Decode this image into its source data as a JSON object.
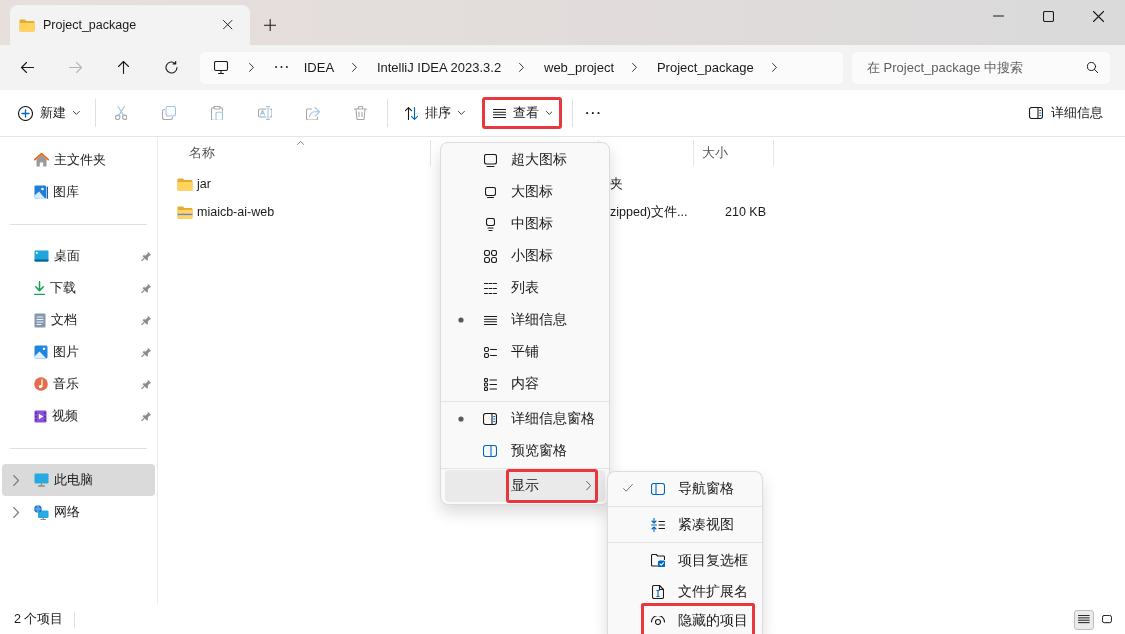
{
  "window": {
    "tabs": [
      {
        "title": "Project_package",
        "selected": true
      }
    ]
  },
  "navigation": {
    "buttons": [
      {
        "kind": "back",
        "disabled": false
      },
      {
        "kind": "forward",
        "disabled": true
      },
      {
        "kind": "up",
        "disabled": false
      },
      {
        "kind": "refresh",
        "disabled": false
      }
    ],
    "breadcrumb": [
      "IDEA",
      "IntelliJ IDEA 2023.3.2",
      "web_project",
      "Project_package"
    ],
    "search": {
      "placeholder": "在 Project_package 中搜索"
    }
  },
  "toolbar": {
    "create": {
      "label": "新建"
    },
    "actions": [
      {
        "kind": "cut",
        "disabled": true
      },
      {
        "kind": "copy",
        "disabled": true
      },
      {
        "kind": "paste",
        "disabled": true
      },
      {
        "kind": "rename",
        "disabled": true
      },
      {
        "kind": "share",
        "disabled": true
      },
      {
        "kind": "delete",
        "disabled": true
      }
    ],
    "sort": {
      "label": "排序"
    },
    "view": {
      "label": "查看",
      "highlighted": true
    },
    "details": {
      "label": "详细信息"
    }
  },
  "sidebar": {
    "groups": [
      [
        {
          "label": "主文件夹",
          "kind": "home",
          "pinned": false,
          "expandable": false,
          "selected": false
        },
        {
          "label": "图库",
          "kind": "gallery",
          "pinned": false,
          "expandable": false,
          "selected": false
        }
      ],
      [
        {
          "label": "桌面",
          "kind": "desktop",
          "pinned": true,
          "expandable": false,
          "selected": false
        },
        {
          "label": "下载",
          "kind": "downloads",
          "pinned": true,
          "expandable": false,
          "selected": false
        },
        {
          "label": "文档",
          "kind": "documents",
          "pinned": true,
          "expandable": false,
          "selected": false
        },
        {
          "label": "图片",
          "kind": "pictures",
          "pinned": true,
          "expandable": false,
          "selected": false
        },
        {
          "label": "音乐",
          "kind": "music",
          "pinned": true,
          "expandable": false,
          "selected": false
        },
        {
          "label": "视频",
          "kind": "videos",
          "pinned": true,
          "expandable": false,
          "selected": false
        }
      ],
      [
        {
          "label": "此电脑",
          "kind": "this-pc",
          "pinned": false,
          "expandable": true,
          "selected": true
        },
        {
          "label": "网络",
          "kind": "network",
          "pinned": false,
          "expandable": true,
          "selected": false
        }
      ]
    ]
  },
  "file_list": {
    "columns": [
      {
        "label": "名称",
        "kind": "name",
        "sorted": true
      },
      {
        "label": "大小",
        "kind": "size",
        "sorted": false
      }
    ],
    "rows": [
      {
        "name": "jar",
        "kind": "folder",
        "type": "夹"
      },
      {
        "name": "miaicb-ai-web",
        "kind": "zip",
        "type": "zipped)文件...",
        "size": "210 KB"
      }
    ]
  },
  "view_menu": {
    "groups": [
      [
        {
          "label": "超大图标",
          "kind": "extra-large-icons",
          "selected": false,
          "hovered": false,
          "highlighted": false
        },
        {
          "label": "大图标",
          "kind": "large-icons",
          "selected": false,
          "hovered": false,
          "highlighted": false
        },
        {
          "label": "中图标",
          "kind": "medium-icons",
          "selected": false,
          "hovered": false,
          "highlighted": false
        },
        {
          "label": "小图标",
          "kind": "small-icons",
          "selected": false,
          "hovered": false,
          "highlighted": false
        },
        {
          "label": "列表",
          "kind": "list",
          "selected": false,
          "hovered": false,
          "highlighted": false
        },
        {
          "label": "详细信息",
          "kind": "details",
          "selected": true,
          "hovered": false,
          "highlighted": false
        },
        {
          "label": "平铺",
          "kind": "tiles",
          "selected": false,
          "hovered": false,
          "highlighted": false
        },
        {
          "label": "内容",
          "kind": "content",
          "selected": false,
          "hovered": false,
          "highlighted": false
        }
      ],
      [
        {
          "label": "详细信息窗格",
          "kind": "details-pane",
          "selected": true,
          "hovered": false,
          "highlighted": false
        },
        {
          "label": "预览窗格",
          "kind": "preview-pane",
          "selected": false,
          "hovered": false,
          "highlighted": false
        }
      ],
      [
        {
          "label": "显示",
          "kind": "submenu",
          "selected": false,
          "hovered": true,
          "highlighted": true
        }
      ]
    ]
  },
  "show_submenu": {
    "groups": [
      [
        {
          "label": "导航窗格",
          "kind": "navigation-pane",
          "checked": true,
          "highlighted": false
        }
      ],
      [
        {
          "label": "紧凑视图",
          "kind": "compact-view",
          "checked": false,
          "highlighted": false
        }
      ],
      [
        {
          "label": "项目复选框",
          "kind": "item-checkboxes",
          "checked": false,
          "highlighted": false
        },
        {
          "label": "文件扩展名",
          "kind": "file-name-extensions",
          "checked": false,
          "highlighted": false
        },
        {
          "label": "隐藏的项目",
          "kind": "hidden-items",
          "checked": false,
          "highlighted": true
        }
      ]
    ]
  },
  "status_bar": {
    "item_count": "2 个项目",
    "view_modes": [
      {
        "kind": "details",
        "selected": true
      },
      {
        "kind": "large-icons",
        "selected": false
      }
    ]
  }
}
